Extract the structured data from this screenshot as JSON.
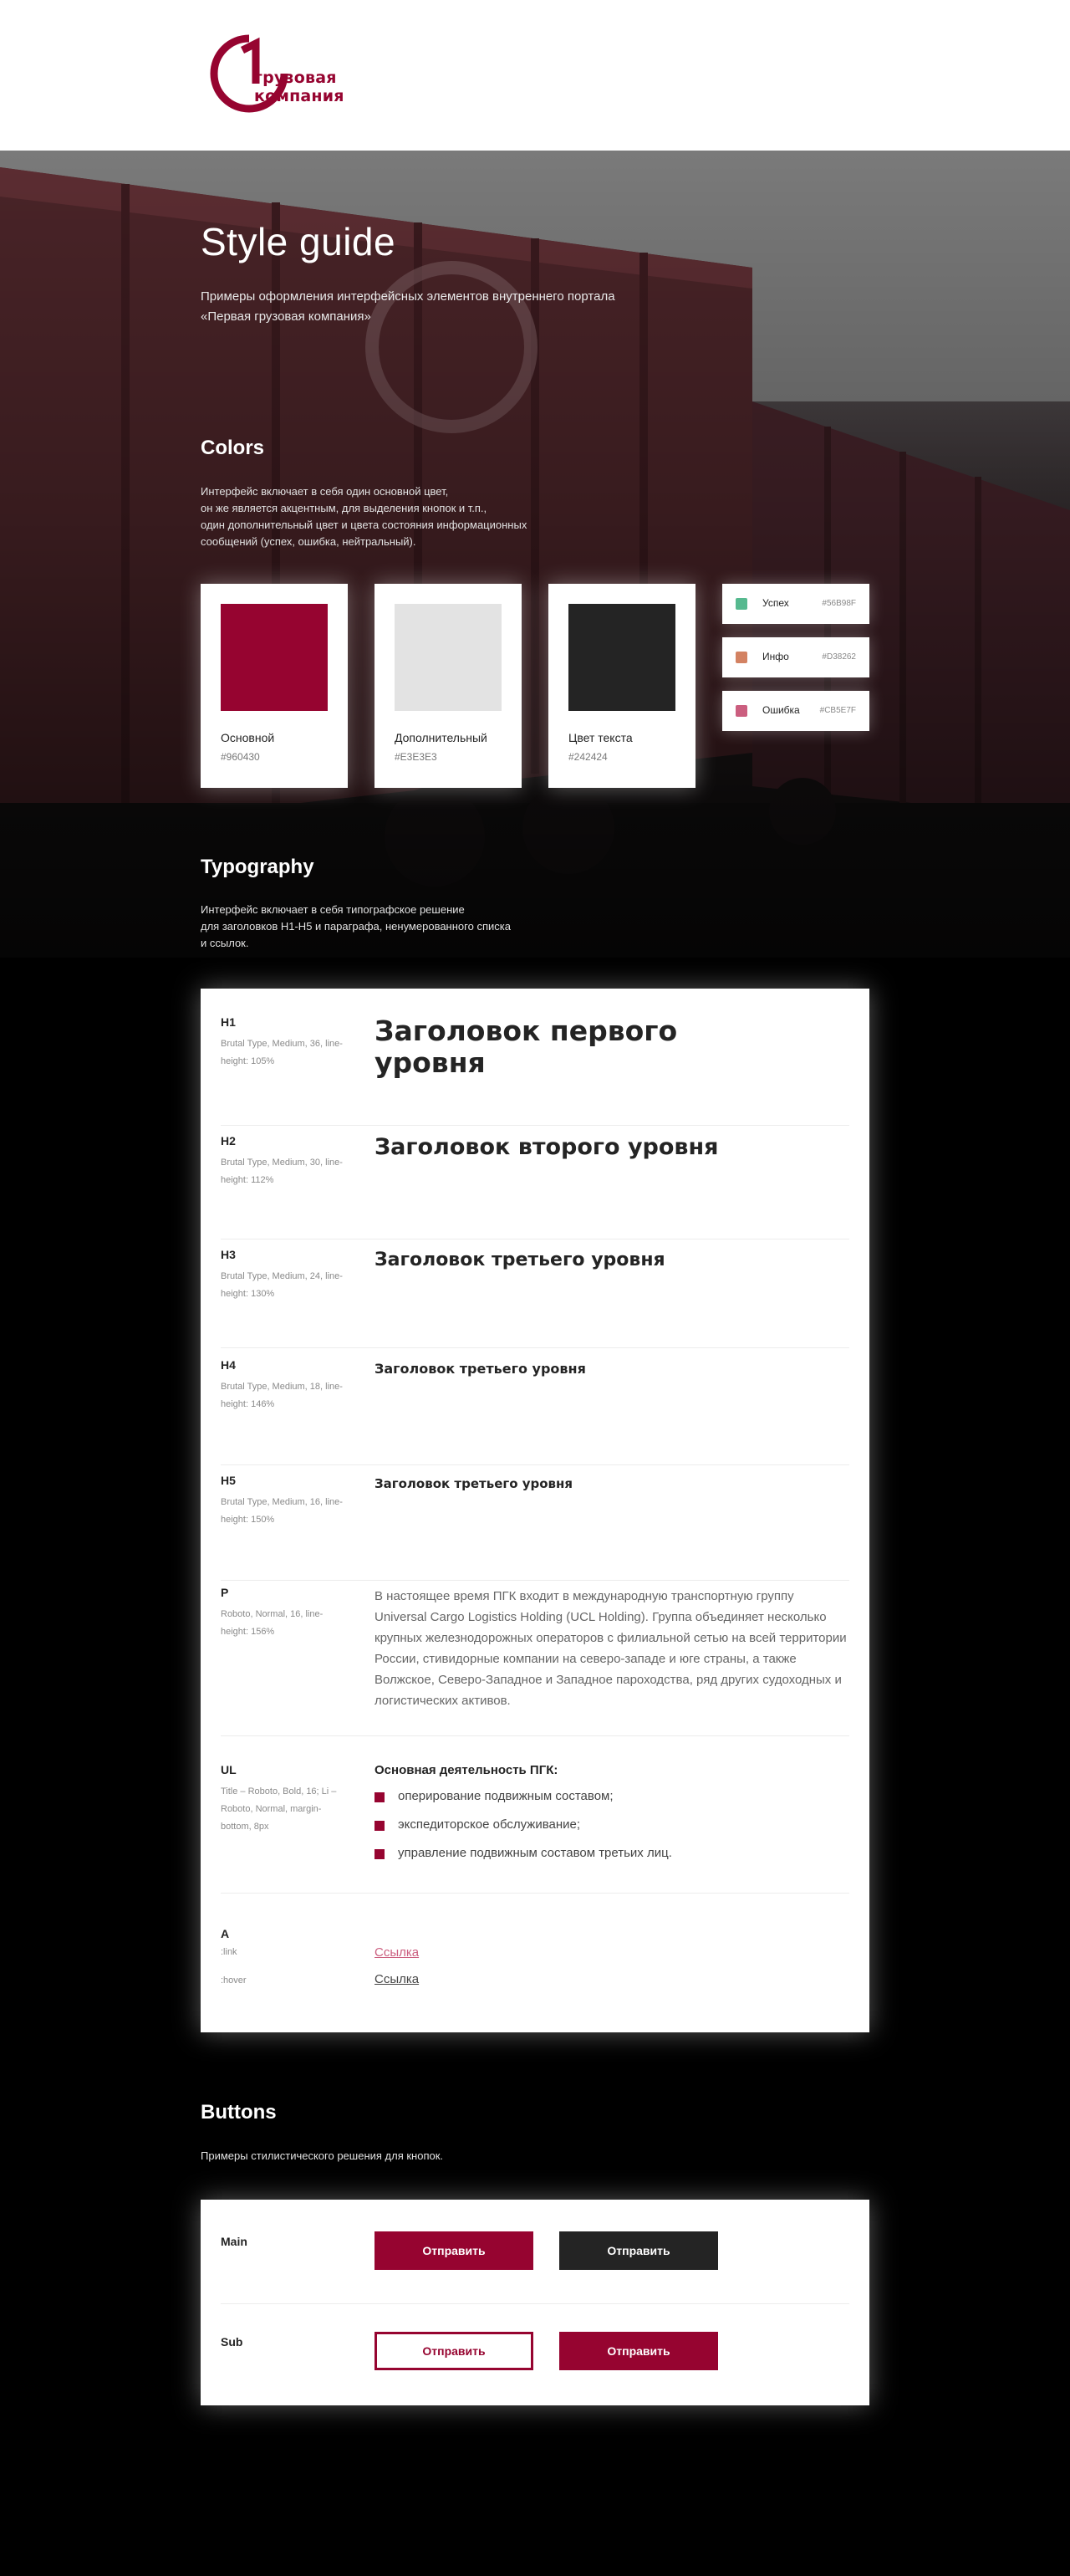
{
  "logo": {
    "line1": "грузовая",
    "line2": "компания",
    "mark": "1"
  },
  "hero": {
    "title": "Style guide",
    "lead": "Примеры оформления интерфейсных элементов внутреннего портала «Первая грузовая компания»"
  },
  "colors": {
    "title": "Colors",
    "text": [
      "Интерфейс включает в себя один основной цвет,",
      "он же является акцентным, для выделения кнопок и т.п.,",
      "один дополнительный цвет и цвета состояния информационных",
      "сообщений (успех, ошибка, нейтральный)."
    ],
    "swatches": [
      {
        "name": "Основной",
        "hex": "#960430"
      },
      {
        "name": "Дополнительный",
        "hex": "#E3E3E3"
      },
      {
        "name": "Цвет текста",
        "hex": "#242424"
      }
    ],
    "states": [
      {
        "name": "Успех",
        "hex": "#56B98F"
      },
      {
        "name": "Инфо",
        "hex": "#D38262"
      },
      {
        "name": "Ошибка",
        "hex": "#CB5E7F"
      }
    ]
  },
  "typography": {
    "title": "Typography",
    "text": [
      "Интерфейс включает в себя типографское решение",
      "для заголовков H1-H5 и параграфа, ненумерованного списка",
      "и ссылок."
    ],
    "h1": {
      "tag": "H1",
      "spec": "Brutal Type, Medium, 36, line-height: 105%",
      "sample": "Заголовок первого уровня"
    },
    "h2": {
      "tag": "H2",
      "spec": "Brutal Type, Medium, 30, line-height: 112%",
      "sample": "Заголовок второго уровня"
    },
    "h3": {
      "tag": "H3",
      "spec": "Brutal Type, Medium, 24, line-height: 130%",
      "sample": "Заголовок третьего уровня"
    },
    "h4": {
      "tag": "H4",
      "spec": "Brutal Type, Medium, 18, line-height: 146%",
      "sample": "Заголовок третьего уровня"
    },
    "h5": {
      "tag": "H5",
      "spec": "Brutal Type, Medium, 16, line-height: 150%",
      "sample": "Заголовок третьего уровня"
    },
    "p": {
      "tag": "P",
      "spec": "Roboto, Normal, 16, line-height: 156%",
      "sample": "В настоящее время ПГК входит в международную транспортную группу Universal Cargo Logistics Holding (UCL Holding). Группа объединяет несколько крупных железнодорожных операторов с филиальной сетью на всей территории России, стивидорные компании на северо-западе и юге страны, а также Волжское, Северо-Западное и Западное пароходства, ряд других судоходных и логистических активов."
    },
    "ul": {
      "tag": "UL",
      "spec": "Title – Roboto, Bold, 16; Li – Roboto, Normal, margin-bottom, 8px",
      "title": "Основная деятельность ПГК:",
      "items": [
        "оперирование подвижным составом;",
        "экспедиторское обслуживание;",
        "управление подвижным составом третьих лиц."
      ]
    },
    "a": {
      "tag": "A",
      "link_state": ":link",
      "hover_state": ":hover",
      "link_text": "Ссылка",
      "hover_text": "Ссылка",
      "link_color": "#CB5E7F",
      "hover_color": "#444444"
    }
  },
  "buttons": {
    "title": "Buttons",
    "text": "Примеры стилистического решения для кнопок.",
    "main_label": "Main",
    "sub_label": "Sub",
    "main_primary": "Отправить",
    "main_dark": "Отправить",
    "sub_outline": "Отправить",
    "sub_primary": "Отправить"
  }
}
